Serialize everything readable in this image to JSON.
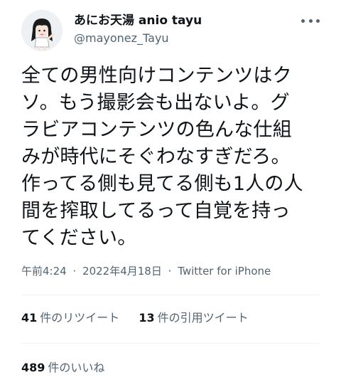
{
  "author": {
    "display_name": "あにお天湯 anio tayu",
    "handle": "@mayonez_Tayu",
    "avatar_icon": "avatar-girl-icon"
  },
  "tweet": {
    "text": "全ての男性向けコンテンツはク\nソ。もう撮影会も出ないよ。グ\nラビアコンテンツの色んな仕組\nみが時代にそぐわなすぎだろ。\n作ってる側も見てる側も1人の人\n間を搾取してるって自覚を持っ\nてください。",
    "time": "午前4:24",
    "separator": "·",
    "date": "2022年4月18日",
    "source": "Twitter for iPhone"
  },
  "stats": {
    "retweets_count": "41",
    "retweets_label": "件のリツイート",
    "quotes_count": "13",
    "quotes_label": "件の引用ツイート",
    "likes_count": "489",
    "likes_label": "件のいいね"
  },
  "colors": {
    "text_primary": "#0f1419",
    "text_secondary": "#536471",
    "divider": "#eff3f4"
  }
}
